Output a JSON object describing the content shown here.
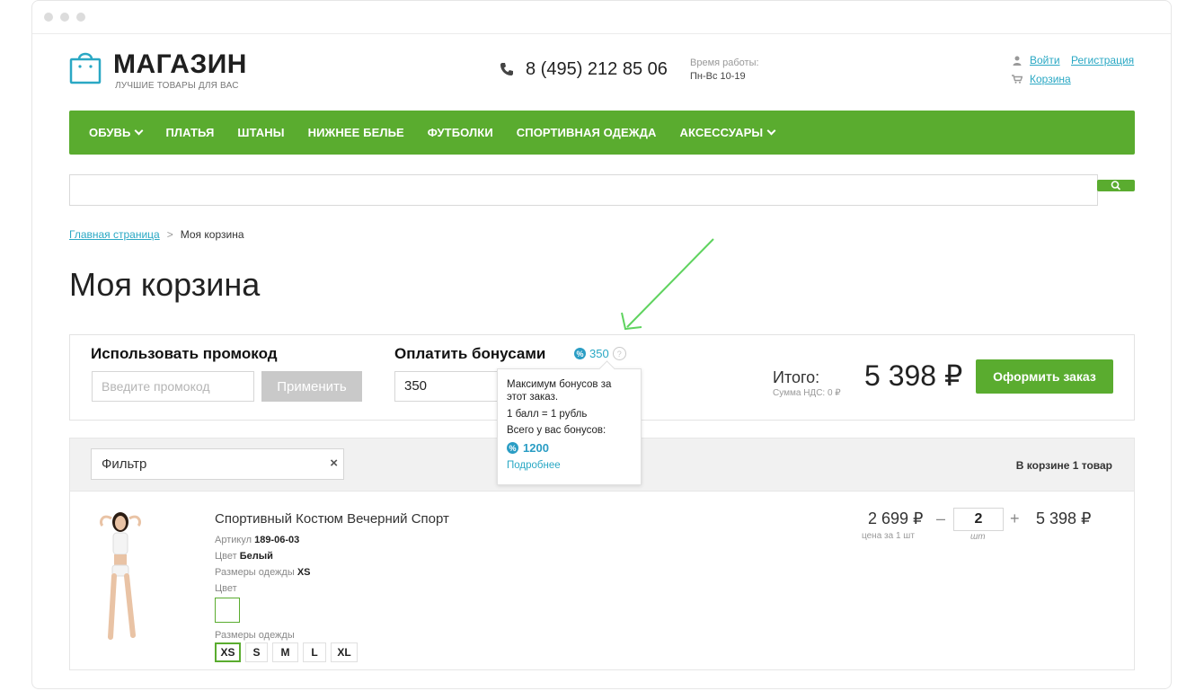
{
  "header": {
    "logo_title": "МАГАЗИН",
    "logo_subtitle": "ЛУЧШИЕ ТОВАРЫ ДЛЯ ВАС",
    "phone": "8 (495) 212 85 06",
    "hours_label": "Время работы:",
    "hours_value": "Пн-Вс 10-19",
    "login": "Войти",
    "register": "Регистрация",
    "cart": "Корзина"
  },
  "nav": {
    "items": [
      {
        "label": "ОБУВЬ",
        "has_dropdown": true
      },
      {
        "label": "ПЛАТЬЯ"
      },
      {
        "label": "ШТАНЫ"
      },
      {
        "label": "НИЖНЕЕ БЕЛЬЕ"
      },
      {
        "label": "ФУТБОЛКИ"
      },
      {
        "label": "СПОРТИВНАЯ ОДЕЖДА"
      },
      {
        "label": "АКСЕССУАРЫ",
        "has_dropdown": true
      }
    ]
  },
  "search": {
    "placeholder": ""
  },
  "breadcrumb": {
    "home": "Главная страница",
    "separator": ">",
    "current": "Моя корзина"
  },
  "page_title": "Моя корзина",
  "promo": {
    "heading": "Использовать промокод",
    "placeholder": "Введите промокод",
    "apply_label": "Применить"
  },
  "bonus": {
    "heading": "Оплатить бонусами",
    "available": "350",
    "input_value": "350",
    "tooltip": {
      "max_line": "Максимум бонусов за этот заказ.",
      "rate_line": "1 балл = 1 рубль",
      "total_label": "Всего у вас бонусов:",
      "total_value": "1200",
      "more_link": "Подробнее"
    }
  },
  "summary": {
    "total_label": "Итого:",
    "vat_label": "Сумма НДС: 0 ₽",
    "total_value": "5 398 ₽",
    "checkout_label": "Оформить заказ"
  },
  "cart_list": {
    "filter_value": "Фильтр",
    "count_label": "В корзине 1 товар"
  },
  "item": {
    "title": "Спортивный Костюм Вечерний Спорт",
    "article_label": "Артикул",
    "article_value": "189-06-03",
    "color_label": "Цвет",
    "color_value": "Белый",
    "sizes_label": "Размеры одежды",
    "size_value": "XS",
    "color_picker_label": "Цвет",
    "size_picker_label": "Размеры одежды",
    "sizes": [
      "XS",
      "S",
      "M",
      "L",
      "XL"
    ],
    "selected_size": "XS",
    "unit_price": "2 699 ₽",
    "unit_price_label": "цена за 1 шт",
    "quantity": "2",
    "quantity_unit": "шт",
    "line_total": "5 398 ₽"
  },
  "colors": {
    "accent_green": "#5aac2f",
    "link_blue": "#2aa8c4",
    "annotation_arrow": "#5fd35f"
  }
}
